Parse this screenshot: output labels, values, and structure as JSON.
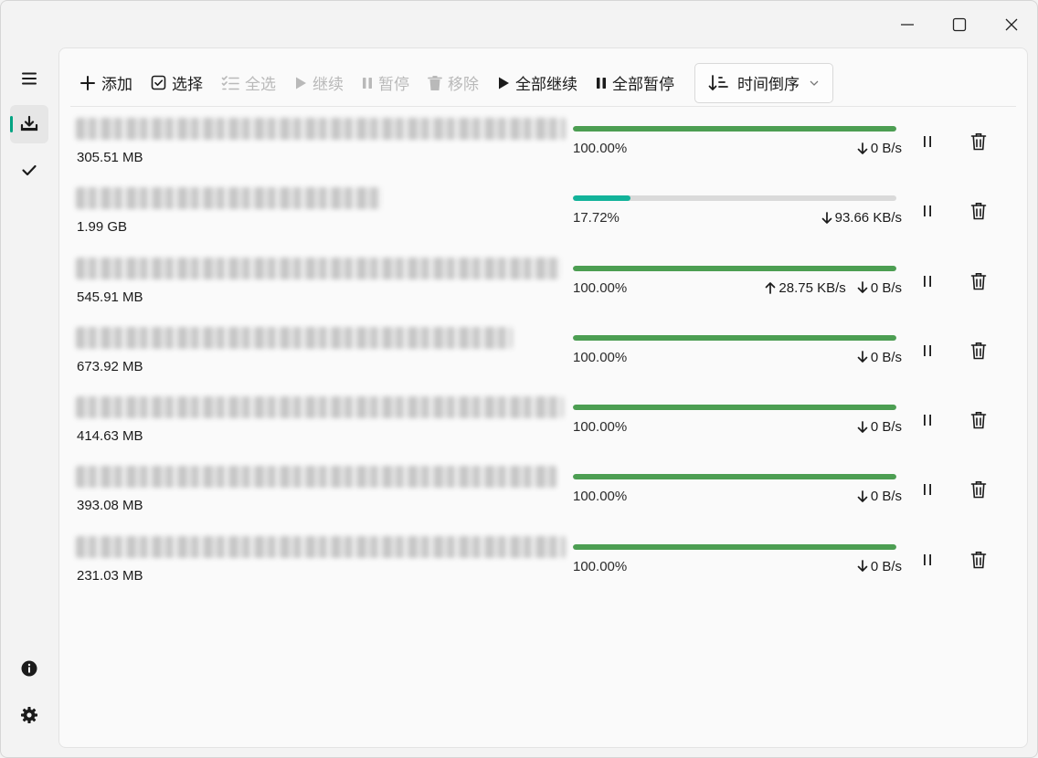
{
  "window": {
    "controls": [
      "minimize-icon",
      "maximize-icon",
      "close-icon"
    ]
  },
  "sidebar": {
    "top_items": [
      {
        "icon": "menu-icon"
      },
      {
        "icon": "download-icon",
        "active": true
      },
      {
        "icon": "check-icon"
      }
    ],
    "bottom_items": [
      {
        "icon": "info-icon"
      },
      {
        "icon": "gear-icon"
      }
    ],
    "accent": "#00a382"
  },
  "toolbar": {
    "add_label": "添加",
    "select_label": "选择",
    "select_all_label": "全选",
    "resume_label": "继续",
    "pause_label": "暂停",
    "remove_label": "移除",
    "resume_all_label": "全部继续",
    "pause_all_label": "全部暂停",
    "sort_label": "时间倒序"
  },
  "colors": {
    "complete": "#4c9e52",
    "active": "#12b39a",
    "track": "#dadada"
  },
  "downloads": [
    {
      "size": "305.51 MB",
      "progress": 1.0,
      "percent": "100.00%",
      "upload": "",
      "download": "0 B/s",
      "name_width": 536
    },
    {
      "size": "1.99 GB",
      "progress": 0.1772,
      "percent": "17.72%",
      "upload": "",
      "download": "93.66 KB/s",
      "name_width": 334
    },
    {
      "size": "545.91 MB",
      "progress": 1.0,
      "percent": "100.00%",
      "upload": "28.75 KB/s",
      "download": "0 B/s",
      "name_width": 530
    },
    {
      "size": "673.92 MB",
      "progress": 1.0,
      "percent": "100.00%",
      "upload": "",
      "download": "0 B/s",
      "name_width": 478
    },
    {
      "size": "414.63 MB",
      "progress": 1.0,
      "percent": "100.00%",
      "upload": "",
      "download": "0 B/s",
      "name_width": 534
    },
    {
      "size": "393.08 MB",
      "progress": 1.0,
      "percent": "100.00%",
      "upload": "",
      "download": "0 B/s",
      "name_width": 526
    },
    {
      "size": "231.03 MB",
      "progress": 1.0,
      "percent": "100.00%",
      "upload": "",
      "download": "0 B/s",
      "name_width": 536
    }
  ]
}
